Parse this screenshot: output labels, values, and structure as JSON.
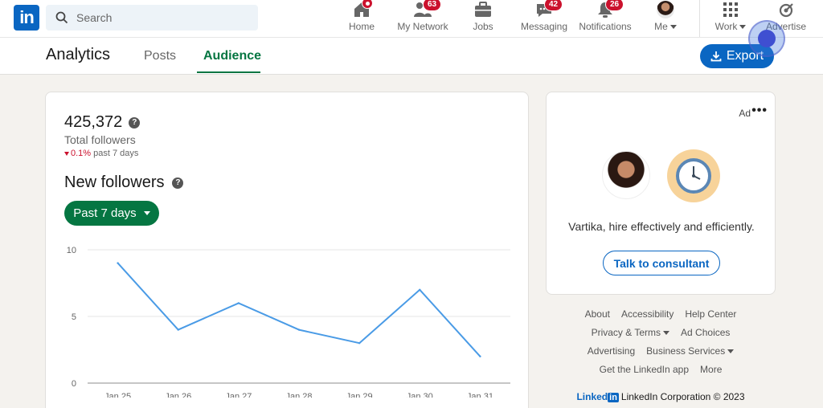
{
  "nav": {
    "search_placeholder": "Search",
    "items": [
      {
        "label": "Home",
        "badge": ""
      },
      {
        "label": "My Network",
        "badge": "63"
      },
      {
        "label": "Jobs",
        "badge": ""
      },
      {
        "label": "Messaging",
        "badge": "42"
      },
      {
        "label": "Notifications",
        "badge": "26"
      },
      {
        "label": "Me"
      },
      {
        "label": "Work"
      },
      {
        "label": "Advertise"
      }
    ]
  },
  "subheader": {
    "title": "Analytics",
    "tabs": [
      "Posts",
      "Audience"
    ],
    "active_tab": "Audience",
    "export_label": "Export"
  },
  "summary": {
    "total": "425,372",
    "total_label": "Total followers",
    "change_pct": "0.1%",
    "change_period": "past 7 days"
  },
  "new_followers": {
    "title": "New followers",
    "range_label": "Past 7 days"
  },
  "chart_data": {
    "type": "line",
    "x": [
      "Jan 25",
      "Jan 26",
      "Jan 27",
      "Jan 28",
      "Jan 29",
      "Jan 30",
      "Jan 31"
    ],
    "y": [
      9,
      4,
      6,
      4,
      3,
      7,
      2
    ],
    "yticks": [
      "10",
      "5",
      "0"
    ],
    "ylim": [
      0,
      10
    ],
    "color": "#4a9be6",
    "grid": true
  },
  "ad": {
    "label": "Ad",
    "text": "Vartika, hire effectively and efficiently.",
    "cta": "Talk to consultant"
  },
  "footer": {
    "row1": [
      "About",
      "Accessibility",
      "Help Center"
    ],
    "row2": [
      "Privacy & Terms",
      "Ad Choices"
    ],
    "row3": [
      "Advertising",
      "Business Services"
    ],
    "row4": [
      "Get the LinkedIn app",
      "More"
    ],
    "brand_word": "Linked",
    "brand_box": "in",
    "corporation": "LinkedIn Corporation © 2023"
  },
  "colors": {
    "brand": "#0a66c2",
    "accent_green": "#057642",
    "badge_red": "#cb112d"
  }
}
